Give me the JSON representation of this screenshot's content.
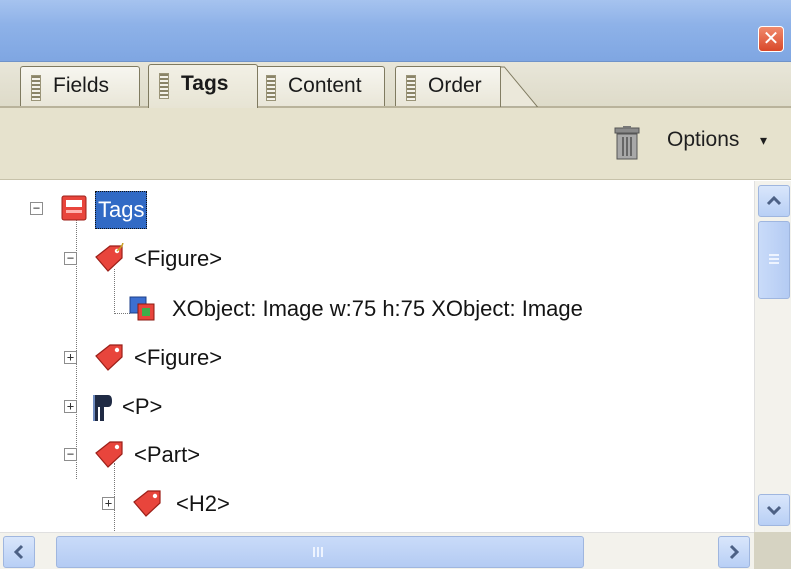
{
  "window": {
    "close_glyph": "✕"
  },
  "tabs": [
    {
      "label": "Fields",
      "active": false
    },
    {
      "label": "Tags",
      "active": true
    },
    {
      "label": "Content",
      "active": false
    },
    {
      "label": "Order",
      "active": false
    }
  ],
  "toolbar": {
    "delete_icon": "trash-icon",
    "options_label": "Options",
    "options_caret": "▾"
  },
  "tree": {
    "rows": [
      {
        "text": "Tags",
        "icon": "tags-root-icon",
        "expander": "−",
        "selected": true
      },
      {
        "text": "<Figure>",
        "icon": "tag-icon",
        "expander": "−"
      },
      {
        "text": "XObject:  Image  w:75 h:75  XObject:  Image",
        "icon": "xobject-image-icon"
      },
      {
        "text": "<Figure>",
        "icon": "tag-icon",
        "expander": "+"
      },
      {
        "text": "<P>",
        "icon": "paragraph-icon",
        "expander": "+"
      },
      {
        "text": "<Part>",
        "icon": "tag-icon",
        "expander": "−"
      },
      {
        "text": "<H2>",
        "icon": "tag-icon",
        "expander": "+"
      }
    ]
  },
  "colors": {
    "titlebar": "#8eb2e8",
    "selection": "#316ac5",
    "tag_red": "#e8453c",
    "toolbar_bg": "#e6e2cd"
  }
}
